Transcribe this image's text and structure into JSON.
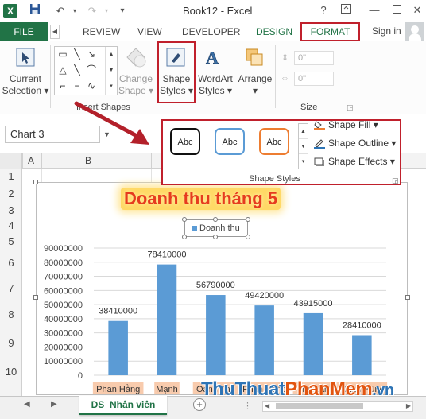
{
  "titlebar": {
    "app_icon": "X",
    "title": "Book12 - Excel",
    "help": "?",
    "minimize": "—",
    "close": "✕"
  },
  "tabs": {
    "file": "FILE",
    "review": "REVIEW",
    "view": "VIEW",
    "developer": "DEVELOPER",
    "design": "DESIGN",
    "format": "FORMAT",
    "sign_in": "Sign in"
  },
  "ribbon": {
    "current_selection": [
      "Current",
      "Selection"
    ],
    "change_shape": [
      "Change",
      "Shape"
    ],
    "shape_styles": [
      "Shape",
      "Styles"
    ],
    "wordart_styles": [
      "WordArt",
      "Styles"
    ],
    "arrange": "Arrange",
    "insert_shapes": "Insert Shapes",
    "size": "Size",
    "height_value": "0\"",
    "width_value": "0\""
  },
  "formula": {
    "name_box": "Chart 3"
  },
  "popup": {
    "styles": [
      "Abc",
      "Abc",
      "Abc"
    ],
    "shape_fill": "Shape Fill",
    "shape_outline": "Shape Outline",
    "shape_effects": "Shape Effects",
    "group_label": "Shape Styles"
  },
  "grid": {
    "columns": [
      "A",
      "B"
    ],
    "rows": [
      "1",
      "2",
      "3",
      "4",
      "5",
      "6",
      "7",
      "8",
      "9",
      "10"
    ]
  },
  "chart_title": "Doanh thu tháng 5",
  "chart_data": {
    "type": "bar",
    "categories": [
      "Phan Hằng",
      "Mạnh",
      "Oanh Thu",
      "Phan Hằng",
      "Thu Lan",
      "Mạnh Hùng"
    ],
    "series": [
      {
        "name": "Doanh thu",
        "values": [
          38410000,
          78410000,
          56790000,
          49420000,
          43915000,
          28410000
        ]
      }
    ],
    "data_labels": [
      "38410000",
      "78410000",
      "56790000",
      "49420000",
      "43915000",
      "28410000"
    ],
    "yticks": [
      "0",
      "10000000",
      "20000000",
      "30000000",
      "40000000",
      "50000000",
      "60000000",
      "70000000",
      "80000000",
      "90000000"
    ],
    "ylim": [
      0,
      90000000
    ],
    "bar_color": "#5b9bd5",
    "category_highlight": "#f8cbad",
    "legend": "top"
  },
  "sheet": {
    "tab": "DS_Nhân viên",
    "add": "+"
  },
  "watermark": {
    "a": "Thu",
    "b": "Thuat",
    "c": "Phan",
    "d": "Mem",
    "e": ".vn"
  },
  "colors": {
    "excel_green": "#217346",
    "highlight_red": "#c0202c",
    "arrow_red": "#b3202a"
  }
}
